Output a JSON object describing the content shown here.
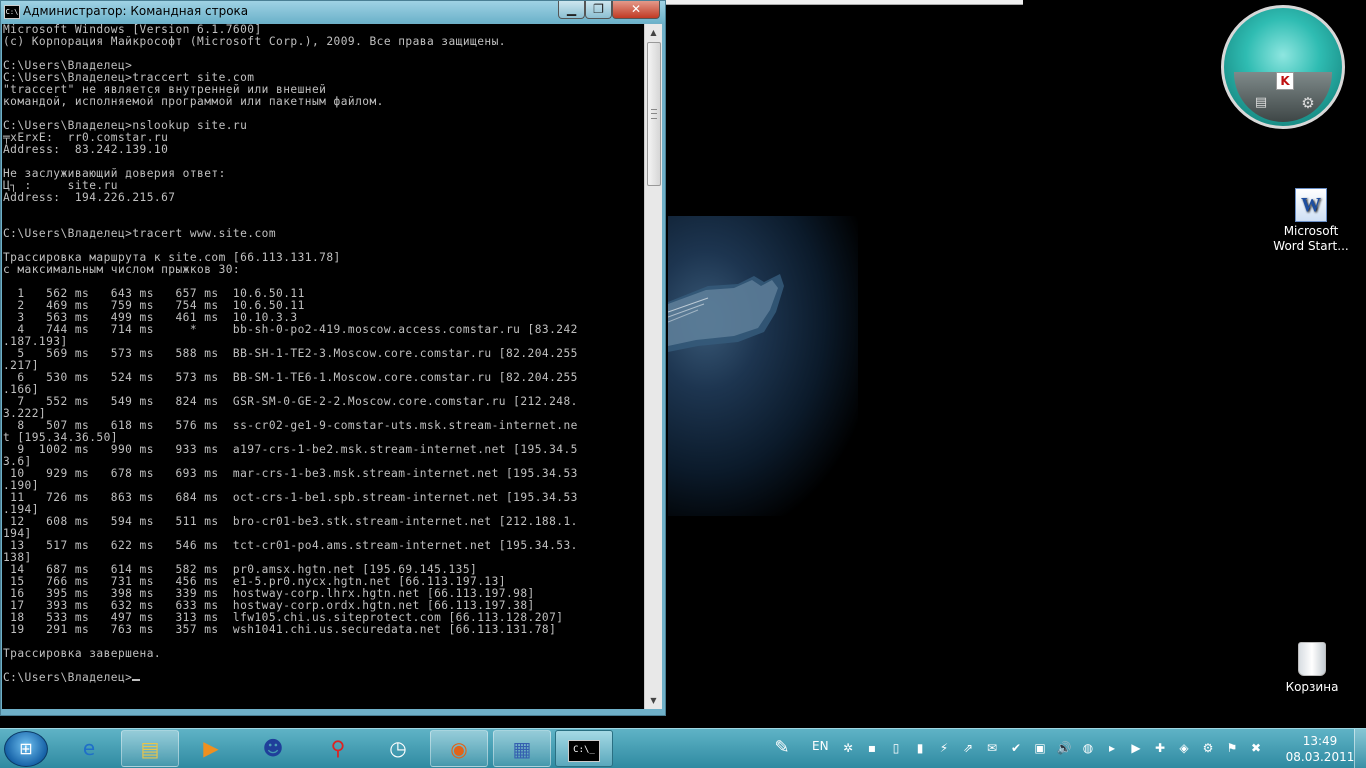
{
  "window": {
    "title": "Администратор: Командная строка",
    "icon_label": "C:\\",
    "min_symbol": "▁",
    "max_symbol": "❐",
    "close_symbol": "✕"
  },
  "console": {
    "lines": [
      "Microsoft Windows [Version 6.1.7600]",
      "(c) Корпорация Майкрософт (Microsoft Corp.), 2009. Все права защищены.",
      "",
      "C:\\Users\\Владелец>",
      "C:\\Users\\Владелец>traccert site.com",
      "\"traccert\" не является внутренней или внешней",
      "командой, исполняемой программой или пакетным файлом.",
      "",
      "C:\\Users\\Владелец>nslookup site.ru",
      "╤xErxE:  rr0.comstar.ru",
      "Address:  83.242.139.10",
      "",
      "Не заслуживающий доверия ответ:",
      "Ц┐ :     site.ru",
      "Address:  194.226.215.67",
      "",
      "",
      "C:\\Users\\Владелец>tracert www.site.com",
      "",
      "Трассировка маршрута к site.com [66.113.131.78]",
      "с максимальным числом прыжков 30:",
      "",
      "  1   562 ms   643 ms   657 ms  10.6.50.11",
      "  2   469 ms   759 ms   754 ms  10.6.50.11",
      "  3   563 ms   499 ms   461 ms  10.10.3.3",
      "  4   744 ms   714 ms     *     bb-sh-0-po2-419.moscow.access.comstar.ru [83.242",
      ".187.193]",
      "  5   569 ms   573 ms   588 ms  BB-SH-1-TE2-3.Moscow.core.comstar.ru [82.204.255",
      ".217]",
      "  6   530 ms   524 ms   573 ms  BB-SM-1-TE6-1.Moscow.core.comstar.ru [82.204.255",
      ".166]",
      "  7   552 ms   549 ms   824 ms  GSR-SM-0-GE-2-2.Moscow.core.comstar.ru [212.248.",
      "3.222]",
      "  8   507 ms   618 ms   576 ms  ss-cr02-ge1-9-comstar-uts.msk.stream-internet.ne",
      "t [195.34.36.50]",
      "  9  1002 ms   990 ms   933 ms  a197-crs-1-be2.msk.stream-internet.net [195.34.5",
      "3.6]",
      " 10   929 ms   678 ms   693 ms  mar-crs-1-be3.msk.stream-internet.net [195.34.53",
      ".190]",
      " 11   726 ms   863 ms   684 ms  oct-crs-1-be1.spb.stream-internet.net [195.34.53",
      ".194]",
      " 12   608 ms   594 ms   511 ms  bro-cr01-be3.stk.stream-internet.net [212.188.1.",
      "194]",
      " 13   517 ms   622 ms   546 ms  tct-cr01-po4.ams.stream-internet.net [195.34.53.",
      "138]",
      " 14   687 ms   614 ms   582 ms  pr0.amsx.hgtn.net [195.69.145.135]",
      " 15   766 ms   731 ms   456 ms  e1-5.pr0.nycx.hgtn.net [66.113.197.13]",
      " 16   395 ms   398 ms   339 ms  hostway-corp.lhrx.hgtn.net [66.113.197.98]",
      " 17   393 ms   632 ms   633 ms  hostway-corp.ordx.hgtn.net [66.113.197.38]",
      " 18   533 ms   497 ms   313 ms  lfw105.chi.us.siteprotect.com [66.113.128.207]",
      " 19   291 ms   763 ms   357 ms  wsh1041.chi.us.securedata.net [66.113.131.78]",
      "",
      "Трассировка завершена.",
      ""
    ],
    "prompt": "C:\\Users\\Владелец>",
    "colors": {
      "background": "#000000",
      "text": "#c0c0c0"
    }
  },
  "scrollbar": {
    "up_arrow": "▲",
    "down_arrow": "▼"
  },
  "kaspersky": {
    "logo": "K",
    "report_icon": "▤",
    "settings_icon": "⚙"
  },
  "desktop_icons": {
    "word": {
      "glyph": "W",
      "label_line1": "Microsoft",
      "label_line2": "Word Start..."
    },
    "recycle_bin": {
      "label": "Корзина"
    }
  },
  "taskbar": {
    "start_glyph": "⊞",
    "pinned": [
      {
        "name": "internet-explorer",
        "glyph": "e"
      },
      {
        "name": "windows-explorer",
        "glyph": "▤"
      },
      {
        "name": "media-player",
        "glyph": "▶"
      },
      {
        "name": "msn-messenger",
        "glyph": "☻"
      },
      {
        "name": "pushpin",
        "glyph": "⚲"
      },
      {
        "name": "clock",
        "glyph": "◷"
      },
      {
        "name": "firefox",
        "glyph": "◉"
      },
      {
        "name": "control-panel",
        "glyph": "▦"
      },
      {
        "name": "command-prompt",
        "glyph": "C:\\_"
      }
    ],
    "tray": {
      "keyboard_glyph": "✎",
      "language": "EN",
      "icons": [
        "✲",
        "▪",
        "▯",
        "▮",
        "⚡",
        "⇗",
        "✉",
        "✔",
        "▣",
        "🔊",
        "◍",
        "▸",
        "▶",
        "✚",
        "◈",
        "⚙",
        "⚑",
        "✖"
      ],
      "time": "13:49",
      "date": "08.03.2011"
    }
  },
  "accent_colors": {
    "taskbar": "#3a96ad",
    "title_bar": "#7bbfd4",
    "close_button": "#c13a24"
  }
}
